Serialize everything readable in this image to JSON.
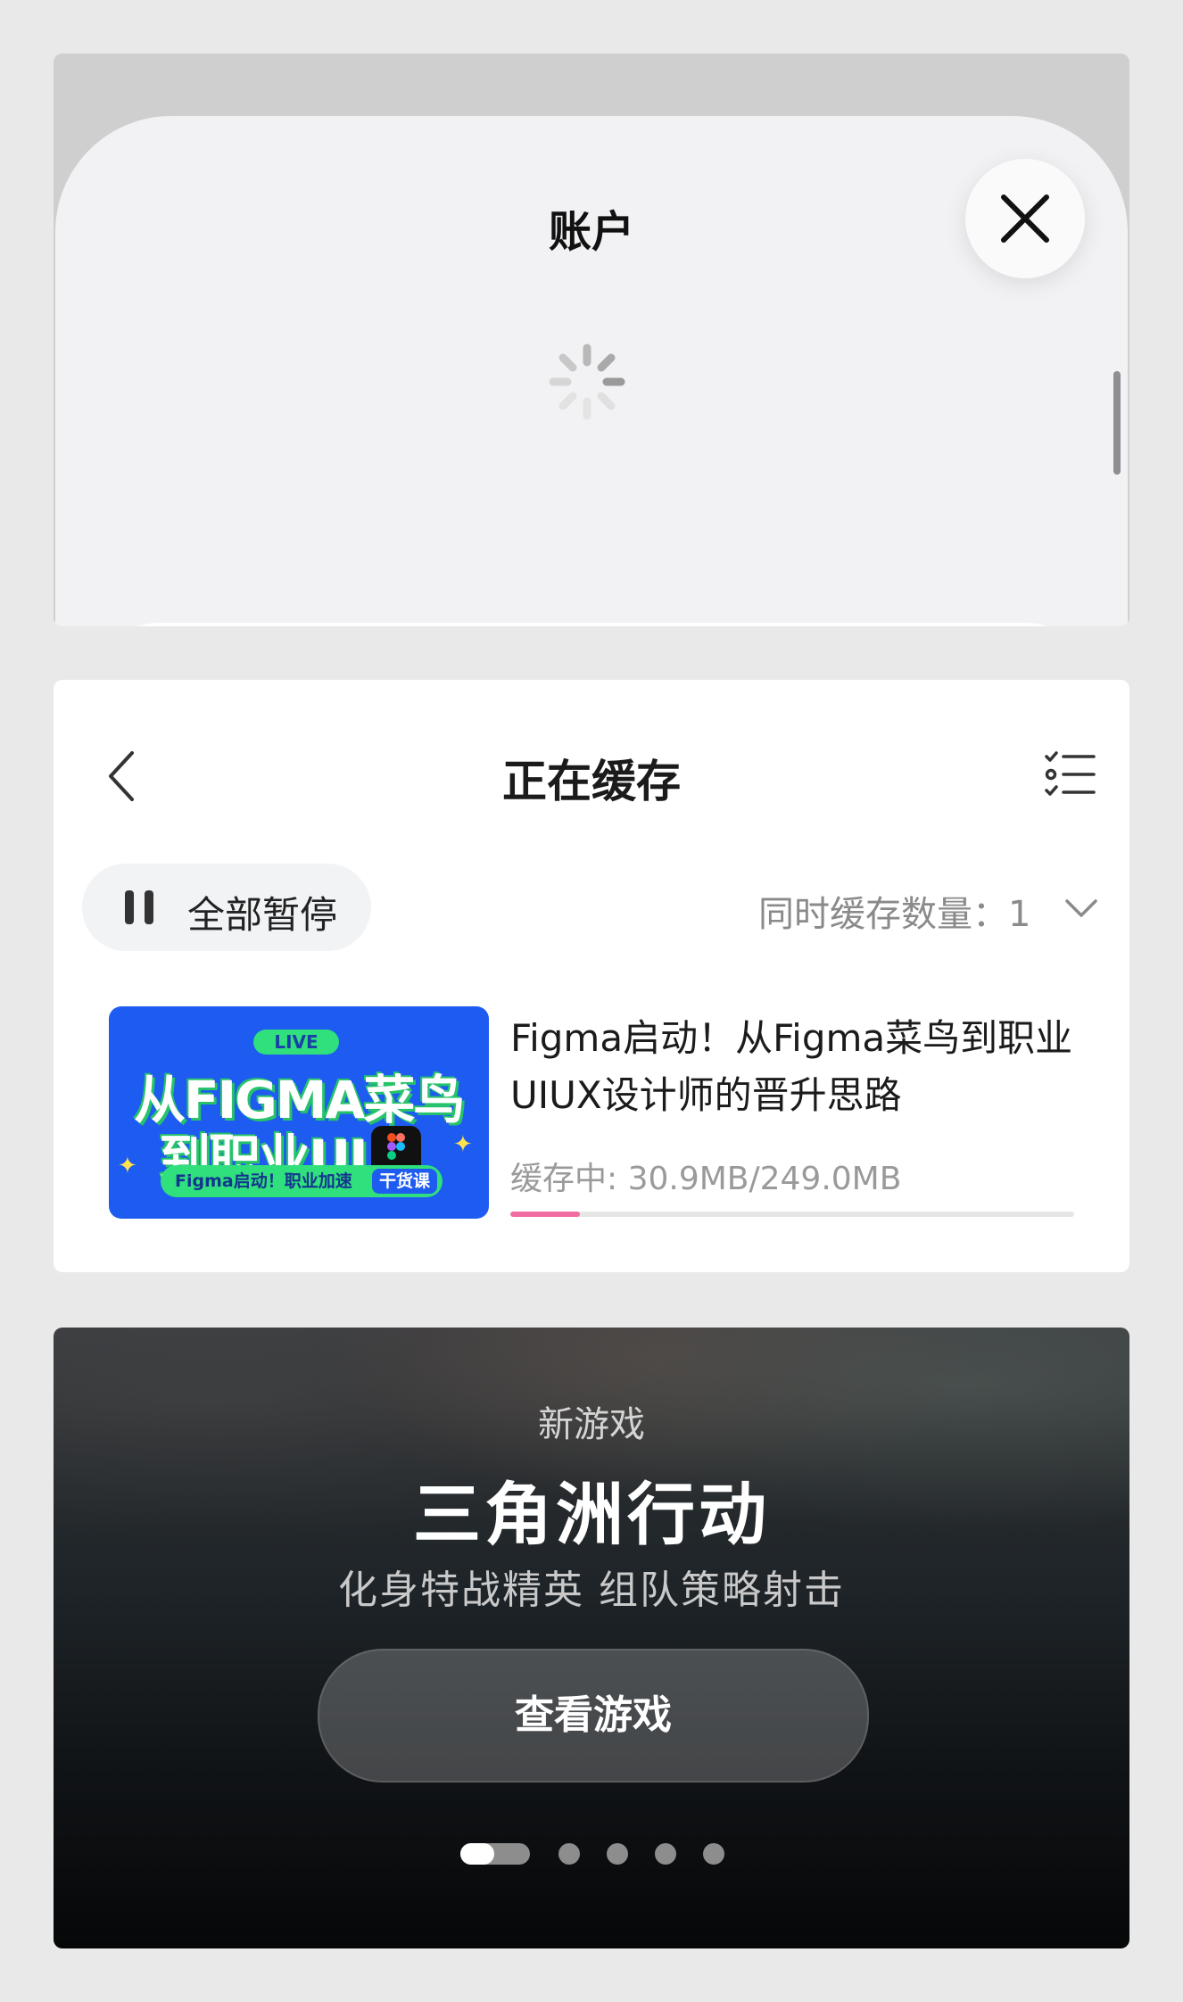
{
  "account_sheet": {
    "title": "账户"
  },
  "downloads": {
    "title": "正在缓存",
    "pause_all_label": "全部暂停",
    "concurrency_label": "同时缓存数量：1",
    "item": {
      "thumbnail": {
        "badge": "LIVE",
        "line1": "从FIGMA菜鸟",
        "line2": "到职业UI",
        "subtitle": "Figma启动！职业加速",
        "tag": "干货课"
      },
      "title": "Figma启动！从Figma菜鸟到职业UIUX设计师的晋升思路",
      "status": "缓存中: 30.9MB/249.0MB",
      "progress": 0.124,
      "progress_color": "#f16ca0"
    }
  },
  "game_promo": {
    "kicker": "新游戏",
    "title": "三角洲行动",
    "subtitle": "化身特战精英 组队策略射击",
    "button_label": "查看游戏",
    "page_count": 5,
    "active_page": 1
  }
}
